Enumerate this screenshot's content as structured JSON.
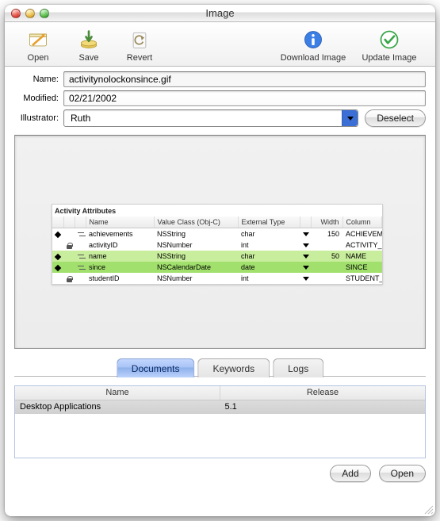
{
  "window": {
    "title": "Image"
  },
  "toolbar": {
    "open": "Open",
    "save": "Save",
    "revert": "Revert",
    "download": "Download Image",
    "update": "Update Image"
  },
  "form": {
    "name_label": "Name:",
    "name_value": "activitynolockonsince.gif",
    "modified_label": "Modified:",
    "modified_value": "02/21/2002",
    "illustrator_label": "Illustrator:",
    "illustrator_value": "Ruth",
    "deselect": "Deselect"
  },
  "preview": {
    "caption": "Activity Attributes",
    "columns": {
      "name": "Name",
      "valueclass": "Value Class (Obj-C)",
      "exttype": "External Type",
      "width": "Width",
      "column": "Column"
    },
    "rows": [
      {
        "dia": true,
        "pk": false,
        "swap": true,
        "name": "achievements",
        "valueclass": "NSString",
        "exttype": "char",
        "tri": true,
        "width": "150",
        "column": "ACHIEVEMENTS",
        "sel": ""
      },
      {
        "dia": false,
        "pk": true,
        "swap": false,
        "name": "activityID",
        "valueclass": "NSNumber",
        "exttype": "int",
        "tri": true,
        "width": "",
        "column": "ACTIVITY_ID",
        "sel": ""
      },
      {
        "dia": true,
        "pk": false,
        "swap": true,
        "name": "name",
        "valueclass": "NSString",
        "exttype": "char",
        "tri": true,
        "width": "50",
        "column": "NAME",
        "sel": "sel2"
      },
      {
        "dia": true,
        "pk": false,
        "swap": true,
        "name": "since",
        "valueclass": "NSCalendarDate",
        "exttype": "date",
        "tri": true,
        "width": "",
        "column": "SINCE",
        "sel": "sel"
      },
      {
        "dia": false,
        "pk": true,
        "swap": false,
        "name": "studentID",
        "valueclass": "NSNumber",
        "exttype": "int",
        "tri": true,
        "width": "",
        "column": "STUDENT_ID",
        "sel": ""
      }
    ]
  },
  "tabs": {
    "documents": "Documents",
    "keywords": "Keywords",
    "logs": "Logs"
  },
  "table": {
    "name_hdr": "Name",
    "release_hdr": "Release",
    "rows": [
      {
        "name": "Desktop Applications",
        "release": "5.1"
      }
    ]
  },
  "buttons": {
    "add": "Add",
    "open": "Open"
  }
}
